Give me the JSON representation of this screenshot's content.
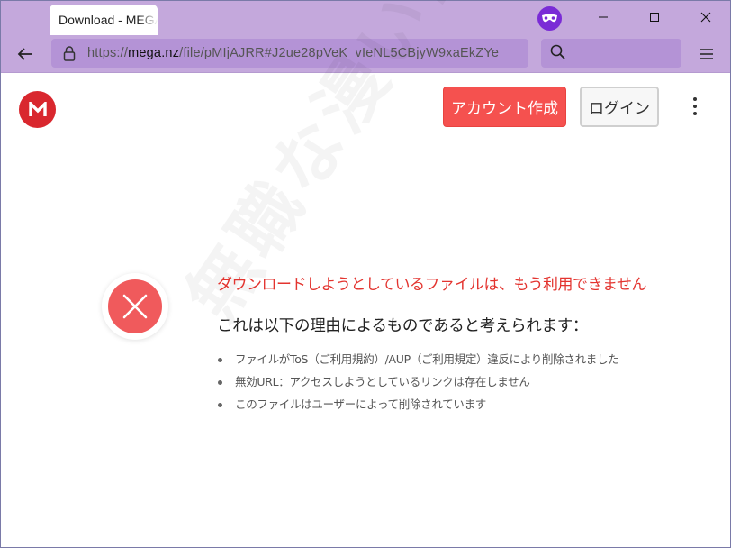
{
  "browser": {
    "tab_title": "Download - MEGA",
    "url_prefix": "https://",
    "url_host": "mega.nz",
    "url_path": "/file/pMIjAJRR#J2ue28pVeK_vIeNL5CBjyW9xaEkZYe",
    "private_icon": "private-browsing-mask-icon",
    "accent_color": "#c4a8dc"
  },
  "header": {
    "logo_letter": "M",
    "create_account_label": "アカウント作成",
    "login_label": "ログイン",
    "brand_color": "#d9272e",
    "create_button_color": "#f5514f"
  },
  "error": {
    "title": "ダウンロードしようとしているファイルは、もう利用できません",
    "subtitle": "これは以下の理由によるものであると考えられます：",
    "reasons": [
      "ファイルがToS（ご利用規約）/AUP（ご利用規定）違反により削除されました",
      "無効URL：アクセスしようとしているリンクは存在しません",
      "このファイルはユーザーによって削除されています"
    ],
    "title_color": "#e3342f"
  },
  "watermark": "無職な漫いログ"
}
